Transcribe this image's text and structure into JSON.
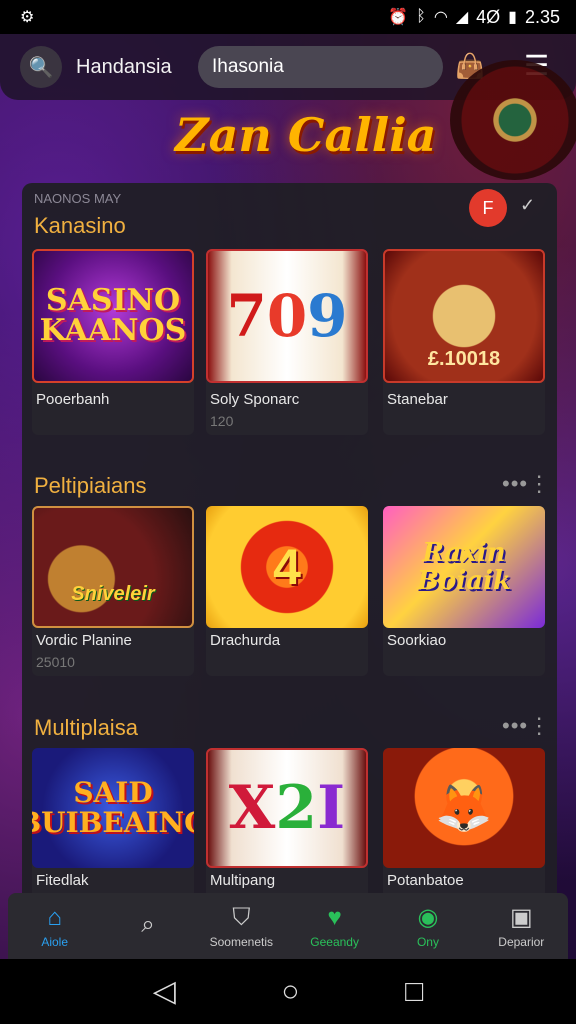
{
  "status_bar": {
    "time": "2.35",
    "carrier_glyph": "4Ø",
    "icons": [
      "notification-icon",
      "alarm-icon",
      "bluetooth-icon",
      "wifi-icon",
      "signal-icon",
      "battery-icon"
    ]
  },
  "header": {
    "brand": "Handansia",
    "search_value": "Ihasonia"
  },
  "banner": {
    "title": "Zan Callia"
  },
  "panel": {
    "subtitle": "NAONOS MAY",
    "badge": "F"
  },
  "sections": [
    {
      "title": "Kanasino",
      "cards": [
        {
          "thumb_text": "SASINO KAANOS",
          "name": "Pooerbanh",
          "meta": ""
        },
        {
          "thumb_text": "709",
          "name": "Soly Sponarc",
          "meta": "120"
        },
        {
          "thumb_text": "£.10018",
          "name": "Stanebar",
          "meta": ""
        }
      ]
    },
    {
      "title": "Peltipiaians",
      "cards": [
        {
          "thumb_text": "Sniveleir",
          "name": "Vordic Planine",
          "meta": "25010"
        },
        {
          "thumb_text": "4",
          "name": "Drachurda",
          "meta": ""
        },
        {
          "thumb_text": "Raxin Boiaik",
          "name": "Soorkiao",
          "meta": ""
        }
      ]
    },
    {
      "title": "Multiplaisa",
      "cards": [
        {
          "thumb_text": "SAID BUIBEAINO",
          "name": "Fitedlak",
          "meta": ""
        },
        {
          "thumb_text": "X2I",
          "name": "Multipang",
          "meta": ""
        },
        {
          "thumb_text": "🦊",
          "name": "Potanbatoe",
          "meta": ""
        }
      ]
    }
  ],
  "bottom_nav": [
    {
      "label": "Aiole",
      "icon": "home-icon",
      "active": true
    },
    {
      "label": "",
      "icon": "search-icon"
    },
    {
      "label": "Soomenetis",
      "icon": "shield-home-icon"
    },
    {
      "label": "Geeandy",
      "icon": "heart-icon"
    },
    {
      "label": "Ony",
      "icon": "chip-icon"
    },
    {
      "label": "Deparior",
      "icon": "wallet-icon"
    }
  ],
  "colors": {
    "section_title": "#f0b040",
    "active_nav": "#2aa0f0",
    "green_nav": "#2ac05a",
    "badge": "#e23a2c"
  }
}
